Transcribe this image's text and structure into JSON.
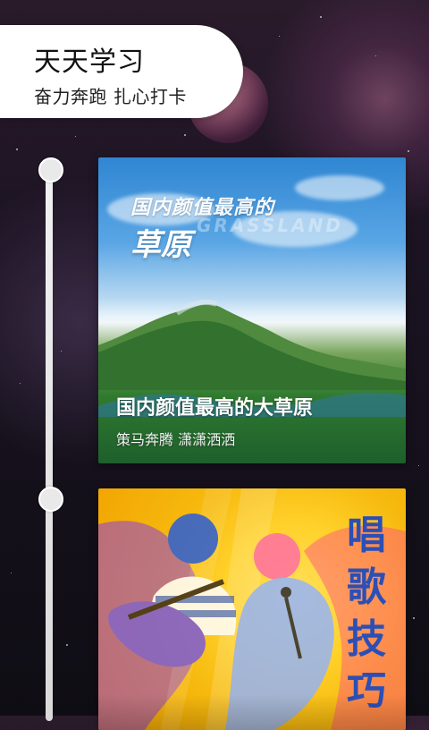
{
  "header": {
    "title": "天天学习",
    "subtitle": "奋力奔跑  扎心打卡"
  },
  "cards": [
    {
      "poster_title_small": "国内颜值最高的",
      "poster_watermark": "GRASSLAND",
      "poster_title_big": "草原",
      "caption_title": "国内颜值最高的大草原",
      "caption_subtitle": "策马奔腾 潇潇洒洒"
    },
    {
      "vertical_title": [
        "唱",
        "歌",
        "技",
        "巧"
      ]
    }
  ],
  "colors": {
    "header_bg": "#ffffff",
    "timeline": "#e6e6e6",
    "accent_blue": "#2b4fb7",
    "sing_yellow": "#ffd12a"
  },
  "icons": {
    "timeline_marker": "circle",
    "music_note": "music-note-icon"
  }
}
